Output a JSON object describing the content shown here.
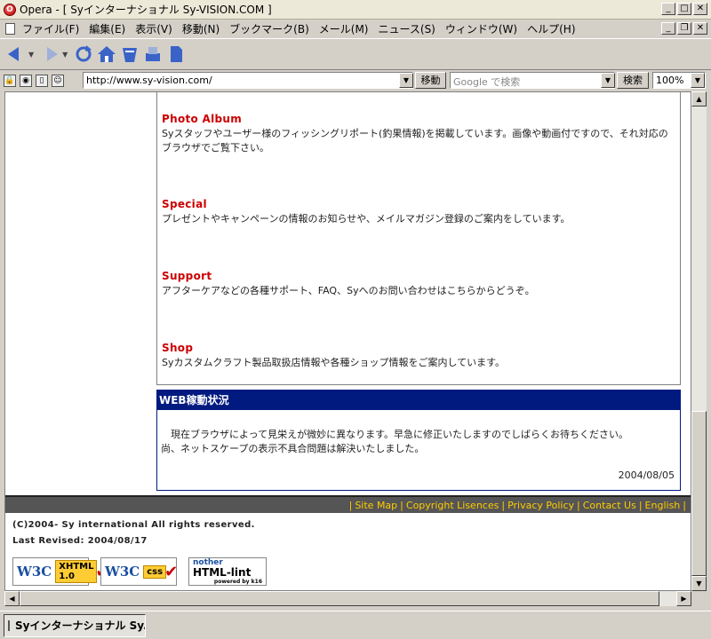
{
  "window": {
    "title": "Opera - [ Syインターナショナル Sy-VISION.COM ]",
    "app_logo": "O"
  },
  "menu": [
    "ファイル(F)",
    "編集(E)",
    "表示(V)",
    "移動(N)",
    "ブックマーク(B)",
    "メール(M)",
    "ニュース(S)",
    "ウィンドウ(W)",
    "ヘルプ(H)"
  ],
  "address": {
    "url": "http://www.sy-vision.com/",
    "go_label": "移動",
    "search_placeholder": "Google で検索",
    "search_label": "検索",
    "zoom": "100%"
  },
  "sections": [
    {
      "heading": "Photo Album",
      "text": "Syスタッフやユーザー様のフィッシングリポート(釣果情報)を掲載しています。画像や動画付ですので、それ対応のブラウザでご覧下さい。"
    },
    {
      "heading": "Special",
      "text": "プレゼントやキャンペーンの情報のお知らせや、メイルマガジン登録のご案内をしています。"
    },
    {
      "heading": "Support",
      "text": "アフターケアなどの各種サポート、FAQ、Syへのお問い合わせはこちらからどうぞ。"
    },
    {
      "heading": "Shop",
      "text": "Syカスタムクラフト製品取扱店情報や各種ショップ情報をご案内しています。"
    }
  ],
  "web_status": {
    "heading": "WEB稼動状況",
    "line1": "　現在ブラウザによって見栄えが微妙に異なります。早急に修正いたしますのでしばらくお待ちください。",
    "line2": "尚、ネットスケープの表示不具合問題は解決いたしました。",
    "date": "2004/08/05"
  },
  "footer": {
    "links": [
      "Site Map",
      "Copyright Lisences",
      "Privacy Policy",
      "Contact Us",
      "English"
    ],
    "copyright": "(C)2004- Sy international All rights reserved.",
    "last_revised": "Last Revised: 2004/08/17",
    "badges": {
      "xhtml_w3c": "W3C",
      "xhtml_label_1": "XHTML",
      "xhtml_label_2": "1.0",
      "css_w3c": "W3C",
      "css_label": "css",
      "lint_top": "nother",
      "lint_main": "HTML-lint",
      "lint_sub": "powered by k16"
    }
  },
  "taskbar": {
    "tab_title": "Syインターナショナル Sy..."
  },
  "icons": [
    "back-icon",
    "forward-icon",
    "reload-icon",
    "home-icon",
    "hotlist-icon",
    "print-icon",
    "page-icon"
  ]
}
